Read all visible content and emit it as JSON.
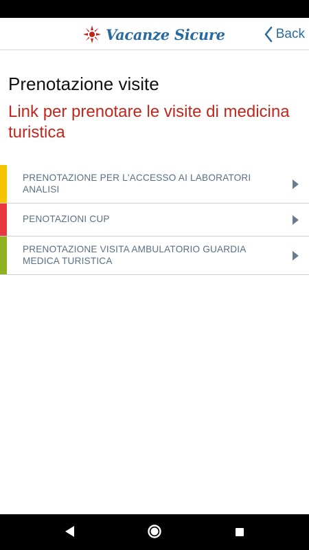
{
  "header": {
    "logo_text": "Vacanze Sicure",
    "back_label": "Back",
    "accent_color": "#2a6aa0",
    "logo_star_color": "#c0271c"
  },
  "page": {
    "title": "Prenotazione visite",
    "subtitle": "Link per prenotare le visite di medicina turistica",
    "subtitle_color": "#c0271c"
  },
  "links": [
    {
      "label": "PRENOTAZIONE PER L'ACCESSO AI LABORATORI ANALISI",
      "stripe_color": "#f5c400"
    },
    {
      "label": "PENOTAZIONI CUP",
      "stripe_color": "#e8373f"
    },
    {
      "label": "PRENOTAZIONE VISITA AMBULATORIO GUARDIA MEDICA TURISTICA",
      "stripe_color": "#8db11f"
    }
  ],
  "icons": {
    "header_back": "chevron-left-icon",
    "list_arrow": "caret-right-icon",
    "nav_back": "triangle-back-icon",
    "nav_home": "circle-home-icon",
    "nav_recent": "square-recent-icon"
  }
}
